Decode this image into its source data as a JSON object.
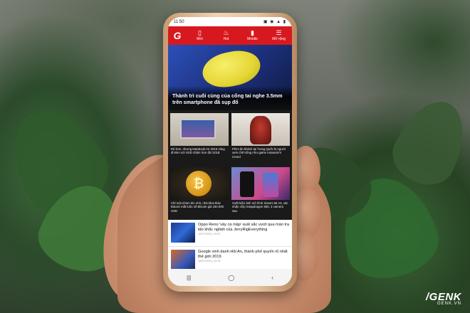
{
  "status_bar": {
    "time": "11:50",
    "icons": "▣ ◉ ▲ ▮"
  },
  "app_bar": {
    "logo": "G",
    "tabs": [
      {
        "label": "Mới",
        "icon": "▯"
      },
      {
        "label": "Hot",
        "icon": "♨"
      },
      {
        "label": "Mobile",
        "icon": "▮"
      },
      {
        "label": "Mở rộng",
        "icon": "☰"
      }
    ]
  },
  "hero": {
    "title": "Thành trì cuối cùng của cổng tai nghe 3.5mm trên smartphone đã sụp đổ"
  },
  "grid_articles": [
    {
      "title": "Rẻ hơn, nhưng MacBook Air 2019 cũng đi kèm với SSD chậm hơn đời 2018"
    },
    {
      "title": "Phim ăn khách tại Trung Quốc bị người xem chê trông như game Assassin's Creed"
    },
    {
      "title": "Chỉ một nhóm lén nhỏ, nhà khai thác Bitcoin mất luôn số Bitcoin giá 150.000 USD"
    },
    {
      "title": "Xuất hiện ảnh mô hình Xiaomi Mi A3, xác nhận chip Snapdragon 665, 3 camera sau"
    }
  ],
  "list_articles": [
    {
      "title": "Oppo Reno 'vây cá mập' xuất sắc vượt qua màn tra tấn khắc nghiệt của JerryRigEverything",
      "date": "16/07/2019 | 10:57"
    },
    {
      "title": "Google vinh danh Hội An, thành phố quyến rũ nhất thế giới 2019",
      "date": "16/07/2019 | 10:32"
    }
  ],
  "nav_bar": {
    "recent": "|||",
    "home": "◯",
    "back": "‹"
  },
  "watermark": {
    "logo": "/GENK",
    "site": "GENK.VN"
  }
}
